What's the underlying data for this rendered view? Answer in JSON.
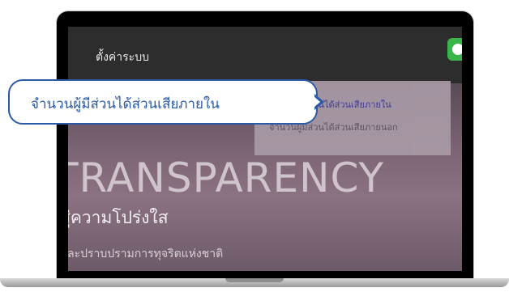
{
  "topbar": {
    "title": "ตั้งค่าระบบ"
  },
  "menu": {
    "items": [
      {
        "label": "จำนวนผู้มีส่วนได้ส่วนเสียภายใน",
        "active": true
      },
      {
        "label": "จำนวนผู้มีส่วนได้ส่วนเสียภายนอก",
        "active": false
      }
    ]
  },
  "hero": {
    "title": "TRANSPARENCY",
    "subtitle": "สู่ความโปร่งใส",
    "tagline": "และปราบปรามการทุจริตแห่งชาติ"
  },
  "callout": {
    "text": "จำนวนผู้มีส่วนได้ส่วนเสียภายใน"
  },
  "colors": {
    "accent": "#2c5aa6",
    "green": "#3ab54a",
    "active_item": "#3d3a9b"
  }
}
